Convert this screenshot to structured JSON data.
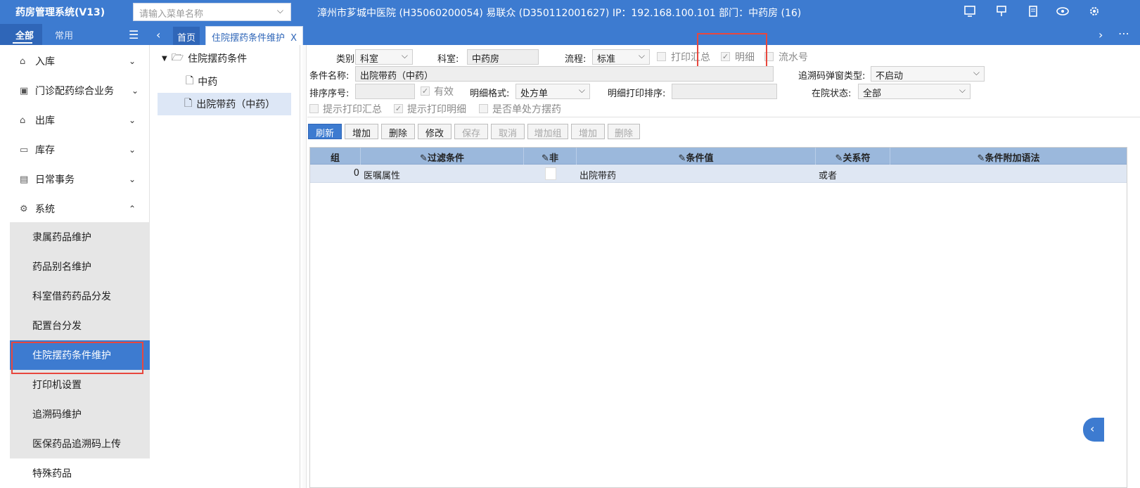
{
  "topbar": {
    "app_title": "药房管理系统(V13)",
    "menu_search_placeholder": "请输入菜单名称",
    "hospital_info": "漳州市芗城中医院 (H35060200054) 易联众 (D350112001627) IP：192.168.100.101 部门：中药房 (16)",
    "icons": [
      "screen-icon",
      "pin-icon",
      "document-icon",
      "eye-icon",
      "settings-icon"
    ]
  },
  "nav": {
    "tab_all": "全部",
    "tab_common": "常用",
    "home_tab": "首页",
    "active_tab": "住院摆药条件维护",
    "active_tab_close": "X"
  },
  "sidebar": {
    "items": [
      {
        "label": "入库",
        "icon": "inbox-icon",
        "arrow": "⌄"
      },
      {
        "label": "门诊配药综合业务",
        "icon": "clinic-icon",
        "arrow": "⌄"
      },
      {
        "label": "出库",
        "icon": "outbox-icon",
        "arrow": "⌄"
      },
      {
        "label": "库存",
        "icon": "stock-icon",
        "arrow": "⌄"
      },
      {
        "label": "日常事务",
        "icon": "calendar-icon",
        "arrow": "⌄"
      },
      {
        "label": "系统",
        "icon": "gear-icon",
        "arrow": "⌃"
      }
    ],
    "sub_items": [
      "隶属药品维护",
      "药品别名维护",
      "科室借药药品分发",
      "配置台分发",
      "住院摆药条件维护",
      "打印机设置",
      "追溯码维护",
      "医保药品追溯码上传"
    ],
    "bottom_item": "特殊药品"
  },
  "tree": {
    "root": "住院摆药条件",
    "children": [
      "中药",
      "出院带药（中药）"
    ]
  },
  "form": {
    "category_label": "类别:",
    "category_value": "科室",
    "dept_label": "科室:",
    "dept_value": "中药房",
    "process_label": "流程:",
    "process_value": "标准",
    "print_summary": "打印汇总",
    "detail": "明细",
    "serial_no": "流水号",
    "cond_name_label": "条件名称:",
    "cond_name_value": "出院带药（中药）",
    "trace_popup_label": "追溯码弹窗类型:",
    "trace_popup_value": "不启动",
    "sort_no_label": "排序序号:",
    "valid": "有效",
    "detail_format_label": "明细格式:",
    "detail_format_value": "处方单",
    "detail_print_sort_label": "明细打印排序:",
    "inhospital_status_label": "在院状态:",
    "inhospital_status_value": "全部",
    "prompt_print_summary": "提示打印汇总",
    "prompt_print_detail": "提示打印明细",
    "single_rx": "是否单处方摆药"
  },
  "toolbar": {
    "refresh": "刷新",
    "add": "增加",
    "delete": "删除",
    "modify": "修改",
    "save": "保存",
    "cancel": "取消",
    "add_group": "增加组",
    "add2": "增加",
    "delete2": "删除"
  },
  "grid": {
    "headers": [
      "组",
      "过滤条件",
      "非",
      "条件值",
      "关系符",
      "条件附加语法"
    ],
    "rows": [
      {
        "group": "0",
        "filter": "医嘱属性",
        "not": "",
        "value": "出院带药",
        "relation": "或者",
        "extra": ""
      }
    ]
  }
}
